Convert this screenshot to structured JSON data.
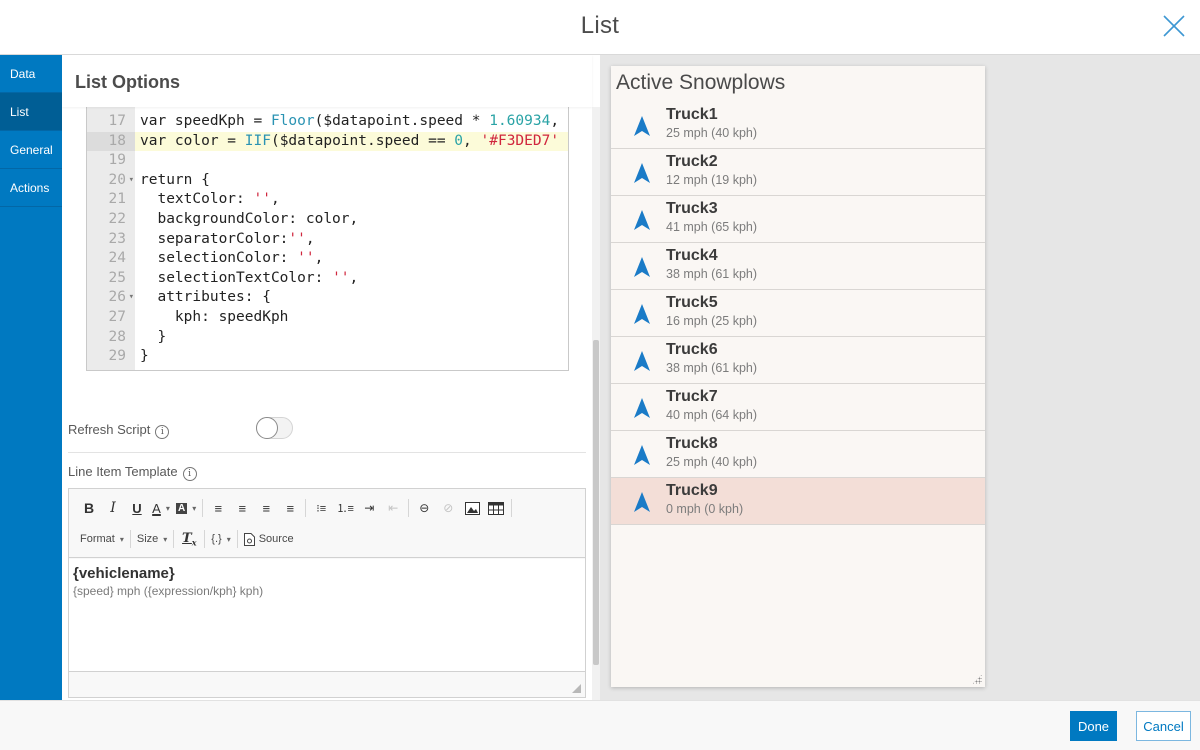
{
  "header": {
    "title": "List",
    "close_icon": "close-icon"
  },
  "sidebar": {
    "items": [
      {
        "label": "Data",
        "active": false
      },
      {
        "label": "List",
        "active": true
      },
      {
        "label": "General",
        "active": false
      },
      {
        "label": "Actions",
        "active": false
      }
    ]
  },
  "settings": {
    "title": "List Options",
    "code": {
      "lines": [
        {
          "n": "17",
          "fold": false,
          "highlight": false,
          "text": "var speedKph = Floor($datapoint.speed * 1.60934,"
        },
        {
          "n": "18",
          "fold": false,
          "highlight": true,
          "text": "var color = IIF($datapoint.speed == 0, '#F3DED7'"
        },
        {
          "n": "19",
          "fold": false,
          "highlight": false,
          "text": ""
        },
        {
          "n": "20",
          "fold": true,
          "highlight": false,
          "text": "return {"
        },
        {
          "n": "21",
          "fold": false,
          "highlight": false,
          "text": "  textColor: '',"
        },
        {
          "n": "22",
          "fold": false,
          "highlight": false,
          "text": "  backgroundColor: color,"
        },
        {
          "n": "23",
          "fold": false,
          "highlight": false,
          "text": "  separatorColor:'',"
        },
        {
          "n": "24",
          "fold": false,
          "highlight": false,
          "text": "  selectionColor: '',"
        },
        {
          "n": "25",
          "fold": false,
          "highlight": false,
          "text": "  selectionTextColor: '',"
        },
        {
          "n": "26",
          "fold": true,
          "highlight": false,
          "text": "  attributes: {"
        },
        {
          "n": "27",
          "fold": false,
          "highlight": false,
          "text": "    kph: speedKph"
        },
        {
          "n": "28",
          "fold": false,
          "highlight": false,
          "text": "  }"
        },
        {
          "n": "29",
          "fold": false,
          "highlight": false,
          "text": "}"
        }
      ]
    },
    "refresh_script": {
      "label": "Refresh Script",
      "enabled": false
    },
    "line_item_template": {
      "label": "Line Item Template",
      "toolbar": {
        "format_label": "Format",
        "size_label": "Size",
        "variables_label": "{.}",
        "source_label": "Source"
      },
      "content_title": "{vehiclename}",
      "content_sub": "{speed} mph ({expression/kph} kph)"
    }
  },
  "preview": {
    "title": "Active Snowplows",
    "stopped_color": "#F3DED7",
    "items": [
      {
        "name": "Truck1",
        "detail": "25 mph (40 kph)",
        "stopped": false
      },
      {
        "name": "Truck2",
        "detail": "12 mph (19 kph)",
        "stopped": false
      },
      {
        "name": "Truck3",
        "detail": "41 mph (65 kph)",
        "stopped": false
      },
      {
        "name": "Truck4",
        "detail": "38 mph (61 kph)",
        "stopped": false
      },
      {
        "name": "Truck5",
        "detail": "16 mph (25 kph)",
        "stopped": false
      },
      {
        "name": "Truck6",
        "detail": "38 mph (61 kph)",
        "stopped": false
      },
      {
        "name": "Truck7",
        "detail": "40 mph (64 kph)",
        "stopped": false
      },
      {
        "name": "Truck8",
        "detail": "25 mph (40 kph)",
        "stopped": false
      },
      {
        "name": "Truck9",
        "detail": "0 mph (0 kph)",
        "stopped": true
      }
    ]
  },
  "footer": {
    "done_label": "Done",
    "cancel_label": "Cancel"
  },
  "colors": {
    "accent": "#0079C1",
    "sidebar_active": "#005E95",
    "icon_blue": "#1A7BC7"
  }
}
